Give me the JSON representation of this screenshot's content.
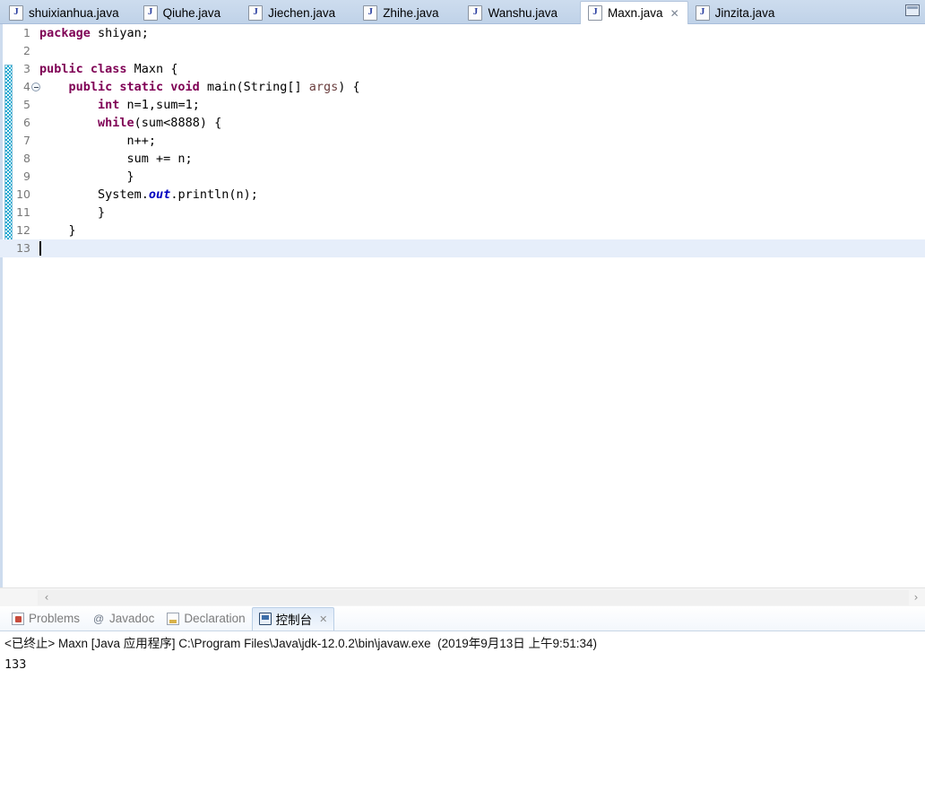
{
  "editor": {
    "tabs": [
      {
        "label": "shuixianhua.java",
        "icon": "java-file-icon",
        "active": false,
        "closable": false
      },
      {
        "label": "Qiuhe.java",
        "icon": "java-file-icon",
        "active": false,
        "closable": false
      },
      {
        "label": "Jiechen.java",
        "icon": "java-file-icon",
        "active": false,
        "closable": false
      },
      {
        "label": "Zhihe.java",
        "icon": "java-file-icon",
        "active": false,
        "closable": false
      },
      {
        "label": "Wanshu.java",
        "icon": "java-file-icon",
        "active": false,
        "closable": false
      },
      {
        "label": "Maxn.java",
        "icon": "java-file-icon",
        "active": true,
        "closable": true
      },
      {
        "label": "Jinzita.java",
        "icon": "java-file-icon",
        "active": false,
        "closable": false
      }
    ],
    "close_glyph": "✕",
    "maximize_icon": "maximize-icon",
    "lines": [
      {
        "no": "1",
        "fold": false,
        "current": false,
        "tokens": [
          {
            "t": "package",
            "c": "kw"
          },
          {
            "t": " shiyan;",
            "c": "plain"
          }
        ]
      },
      {
        "no": "2",
        "fold": false,
        "current": false,
        "tokens": []
      },
      {
        "no": "3",
        "fold": false,
        "current": false,
        "tokens": [
          {
            "t": "public class",
            "c": "kw"
          },
          {
            "t": " Maxn {",
            "c": "plain"
          }
        ]
      },
      {
        "no": "4",
        "fold": true,
        "current": false,
        "tokens": [
          {
            "t": "    ",
            "c": "plain"
          },
          {
            "t": "public static void",
            "c": "kw"
          },
          {
            "t": " main(String[] ",
            "c": "plain"
          },
          {
            "t": "args",
            "c": "prm"
          },
          {
            "t": ") {",
            "c": "plain"
          }
        ]
      },
      {
        "no": "5",
        "fold": false,
        "current": false,
        "tokens": [
          {
            "t": "        ",
            "c": "plain"
          },
          {
            "t": "int",
            "c": "kw"
          },
          {
            "t": " n=1,sum=1;",
            "c": "plain"
          }
        ]
      },
      {
        "no": "6",
        "fold": false,
        "current": false,
        "tokens": [
          {
            "t": "        ",
            "c": "plain"
          },
          {
            "t": "while",
            "c": "kw"
          },
          {
            "t": "(sum<8888) {",
            "c": "plain"
          }
        ]
      },
      {
        "no": "7",
        "fold": false,
        "current": false,
        "tokens": [
          {
            "t": "            n++;",
            "c": "plain"
          }
        ]
      },
      {
        "no": "8",
        "fold": false,
        "current": false,
        "tokens": [
          {
            "t": "            sum += n;",
            "c": "plain"
          }
        ]
      },
      {
        "no": "9",
        "fold": false,
        "current": false,
        "tokens": [
          {
            "t": "            }",
            "c": "plain"
          }
        ]
      },
      {
        "no": "10",
        "fold": false,
        "current": false,
        "tokens": [
          {
            "t": "        System.",
            "c": "plain"
          },
          {
            "t": "out",
            "c": "fld"
          },
          {
            "t": ".println(n);",
            "c": "plain"
          }
        ]
      },
      {
        "no": "11",
        "fold": false,
        "current": false,
        "tokens": [
          {
            "t": "        }",
            "c": "plain"
          }
        ]
      },
      {
        "no": "12",
        "fold": false,
        "current": false,
        "tokens": [
          {
            "t": "    }",
            "c": "plain"
          }
        ]
      },
      {
        "no": "13",
        "fold": false,
        "current": true,
        "tokens": []
      }
    ],
    "scroll_left_glyph": "‹",
    "scroll_right_glyph": "›"
  },
  "bottom": {
    "tabs": [
      {
        "label": "Problems",
        "icon": "problems-icon",
        "active": false,
        "closable": false
      },
      {
        "label": "Javadoc",
        "icon": "javadoc-icon",
        "active": false,
        "closable": false
      },
      {
        "label": "Declaration",
        "icon": "declaration-icon",
        "active": false,
        "closable": false
      },
      {
        "label": "控制台",
        "icon": "console-icon",
        "active": true,
        "closable": true
      }
    ],
    "close_glyph": "✕",
    "javadoc_glyph": "@",
    "console": {
      "header": "<已终止> Maxn [Java 应用程序] C:\\Program Files\\Java\\jdk-12.0.2\\bin\\javaw.exe  (2019年9月13日 上午9:51:34)",
      "output": "133"
    }
  },
  "colors": {
    "tabbar": "#c6d7eb",
    "keyword": "#7f0055",
    "field": "#0000c0",
    "parameter": "#6a3e3e",
    "current_line": "#e6eefa",
    "quickdiff": "#1aa7d0"
  }
}
